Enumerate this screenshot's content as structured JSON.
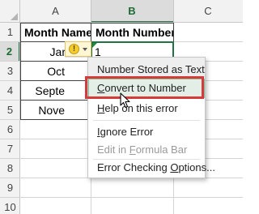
{
  "columns": [
    "A",
    "B",
    "C"
  ],
  "rows": [
    "1",
    "2",
    "3",
    "4",
    "5",
    "6",
    "7",
    "8",
    "9",
    "10"
  ],
  "cells": {
    "A1": "Month Name",
    "B1": "Month Number",
    "A2": "Jar",
    "B2": "1",
    "A3": "Oct",
    "A4": "Septe",
    "A5": "Nove"
  },
  "menu": {
    "title": "Number Stored as Text",
    "convert_pre": "",
    "convert_key": "C",
    "convert_post": "onvert to Number",
    "help_pre": "",
    "help_key": "H",
    "help_post": "elp on this error",
    "ignore_pre": "",
    "ignore_key": "I",
    "ignore_post": "gnore Error",
    "edit_pre": "Edit in ",
    "edit_key": "F",
    "edit_post": "ormula Bar",
    "options_pre": "Error Checking ",
    "options_key": "O",
    "options_post": "ptions..."
  },
  "colors": {
    "accent_green": "#217346",
    "highlight_red": "#d63b3b",
    "warning_yellow": "#f5cd2c"
  },
  "icons": {
    "error_tag": "warning-icon",
    "dropdown": "chevron-down-icon"
  }
}
